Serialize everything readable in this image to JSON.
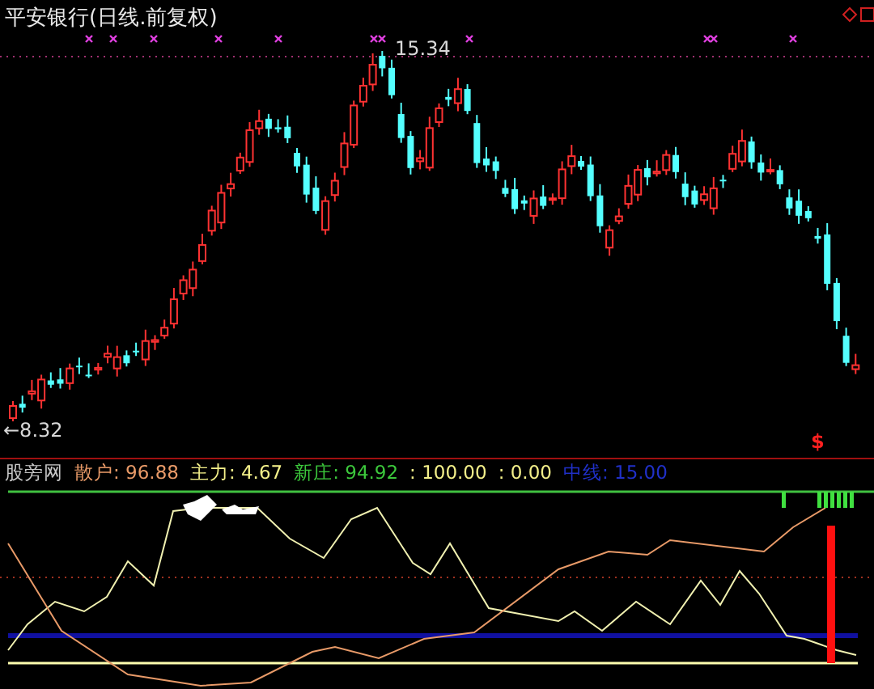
{
  "chart": {
    "title": "平安银行(日线.前复权)",
    "high_label": "15.34",
    "low_label": "←8.32",
    "signal_mark": "$"
  },
  "indicator": {
    "name": "股旁网",
    "values": [
      {
        "text": "散户: 96.88",
        "color": "#e89a68"
      },
      {
        "text": "主力: 4.67",
        "color": "#f4f08a"
      },
      {
        "text": "新庄: 94.92",
        "color": "#3cc83c"
      },
      {
        "text": ": 100.00",
        "color": "#f4f08a"
      },
      {
        "text": ": 0.00",
        "color": "#f4f08a"
      },
      {
        "text": "中线: 15.00",
        "color": "#2030c8"
      }
    ]
  }
}
